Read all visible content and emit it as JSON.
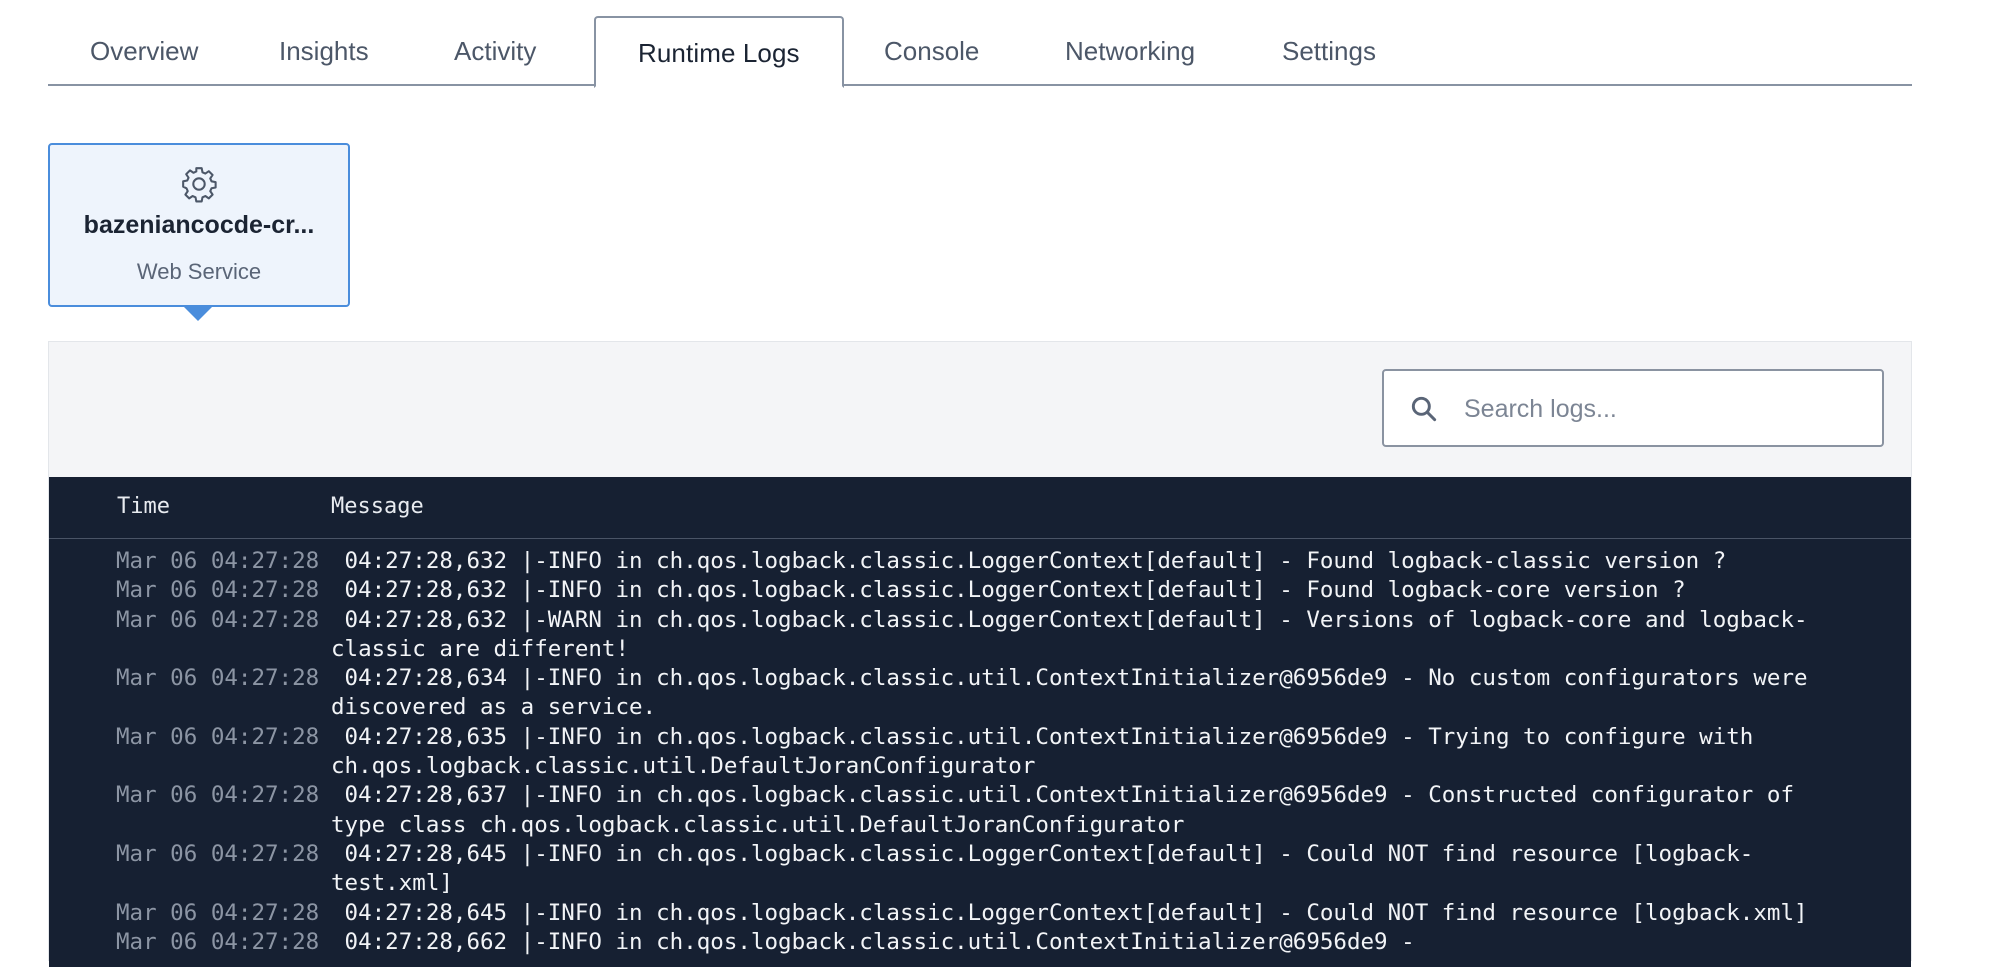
{
  "tabs": [
    {
      "label": "Overview",
      "active": false
    },
    {
      "label": "Insights",
      "active": false
    },
    {
      "label": "Activity",
      "active": false
    },
    {
      "label": "Runtime Logs",
      "active": true
    },
    {
      "label": "Console",
      "active": false
    },
    {
      "label": "Networking",
      "active": false
    },
    {
      "label": "Settings",
      "active": false
    }
  ],
  "service": {
    "icon": "gear-icon",
    "name": "bazeniancocde-cr...",
    "type": "Web Service"
  },
  "search": {
    "placeholder": "Search logs...",
    "value": "",
    "icon": "search-icon"
  },
  "logs": {
    "columns": {
      "time": "Time",
      "message": "Message"
    },
    "rows": [
      {
        "time": "Mar 06 04:27:28",
        "message": " 04:27:28,632 |-INFO in ch.qos.logback.classic.LoggerContext[default] - Found logback-classic version ?"
      },
      {
        "time": "Mar 06 04:27:28",
        "message": " 04:27:28,632 |-INFO in ch.qos.logback.classic.LoggerContext[default] - Found logback-core version ?"
      },
      {
        "time": "Mar 06 04:27:28",
        "message": " 04:27:28,632 |-WARN in ch.qos.logback.classic.LoggerContext[default] - Versions of logback-core and logback-\nclassic are different!"
      },
      {
        "time": "Mar 06 04:27:28",
        "message": " 04:27:28,634 |-INFO in ch.qos.logback.classic.util.ContextInitializer@6956de9 - No custom configurators were\ndiscovered as a service."
      },
      {
        "time": "Mar 06 04:27:28",
        "message": " 04:27:28,635 |-INFO in ch.qos.logback.classic.util.ContextInitializer@6956de9 - Trying to configure with\nch.qos.logback.classic.util.DefaultJoranConfigurator"
      },
      {
        "time": "Mar 06 04:27:28",
        "message": " 04:27:28,637 |-INFO in ch.qos.logback.classic.util.ContextInitializer@6956de9 - Constructed configurator of\ntype class ch.qos.logback.classic.util.DefaultJoranConfigurator"
      },
      {
        "time": "Mar 06 04:27:28",
        "message": " 04:27:28,645 |-INFO in ch.qos.logback.classic.LoggerContext[default] - Could NOT find resource [logback-\ntest.xml]"
      },
      {
        "time": "Mar 06 04:27:28",
        "message": " 04:27:28,645 |-INFO in ch.qos.logback.classic.LoggerContext[default] - Could NOT find resource [logback.xml]"
      },
      {
        "time": "Mar 06 04:27:28",
        "message": " 04:27:28,662 |-INFO in ch.qos.logback.classic.util.ContextInitializer@6956de9 -"
      }
    ]
  },
  "colors": {
    "accent": "#4a8ddc",
    "log_background": "#162032",
    "panel_background": "#f4f5f7"
  }
}
